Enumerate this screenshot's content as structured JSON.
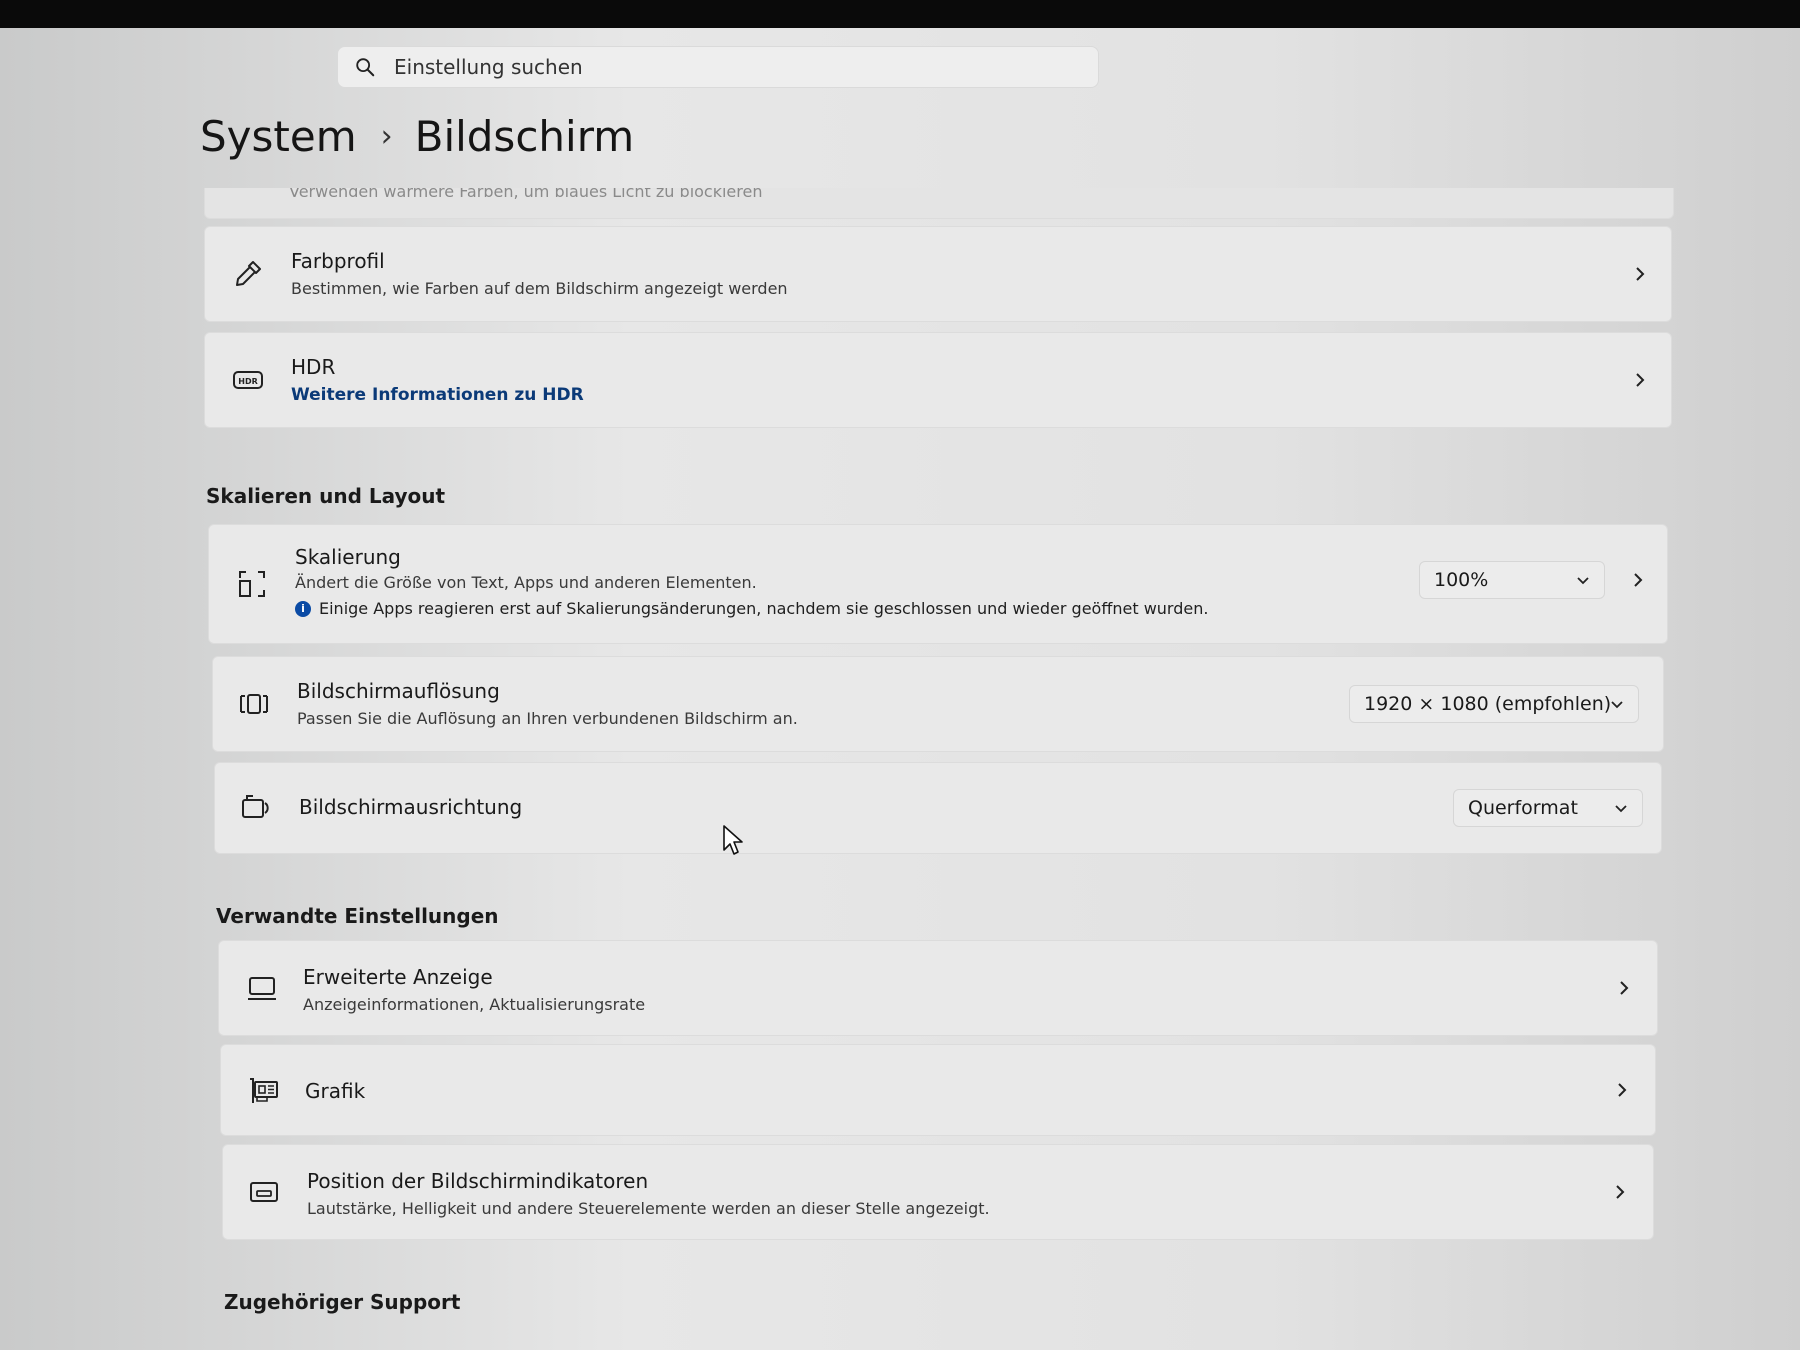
{
  "search": {
    "placeholder": "Einstellung suchen"
  },
  "breadcrumb": {
    "parent": "System",
    "separator": "›",
    "current": "Bildschirm"
  },
  "clipped_text": "Verwenden wärmere Farben, um blaues Licht zu blockieren",
  "cards_top": [
    {
      "title": "Farbprofil",
      "description": "Bestimmen, wie Farben auf dem Bildschirm angezeigt werden",
      "icon": "eyedropper-icon"
    },
    {
      "title": "HDR",
      "link": "Weitere Informationen zu HDR",
      "icon": "hdr-icon"
    }
  ],
  "sections": {
    "scale_layout": "Skalieren und Layout",
    "related": "Verwandte Einstellungen",
    "support": "Zugehöriger Support"
  },
  "scaling": {
    "title": "Skalierung",
    "description": "Ändert die Größe von Text, Apps und anderen Elementen.",
    "info_glyph": "i",
    "note": "Einige Apps reagieren erst auf Skalierungsänderungen, nachdem sie geschlossen und wieder geöffnet wurden.",
    "value": "100%"
  },
  "resolution": {
    "title": "Bildschirmauflösung",
    "description": "Passen Sie die Auflösung an Ihren verbundenen Bildschirm an.",
    "value": "1920 × 1080 (empfohlen)"
  },
  "orientation": {
    "title": "Bildschirmausrichtung",
    "value": "Querformat"
  },
  "related": [
    {
      "title": "Erweiterte Anzeige",
      "description": "Anzeigeinformationen, Aktualisierungsrate",
      "icon": "monitor-icon"
    },
    {
      "title": "Grafik",
      "icon": "graphics-card-icon"
    },
    {
      "title": "Position der Bildschirmindikatoren",
      "description": "Lautstärke, Helligkeit und andere Steuerelemente werden an dieser Stelle angezeigt.",
      "icon": "indicator-position-icon"
    }
  ]
}
